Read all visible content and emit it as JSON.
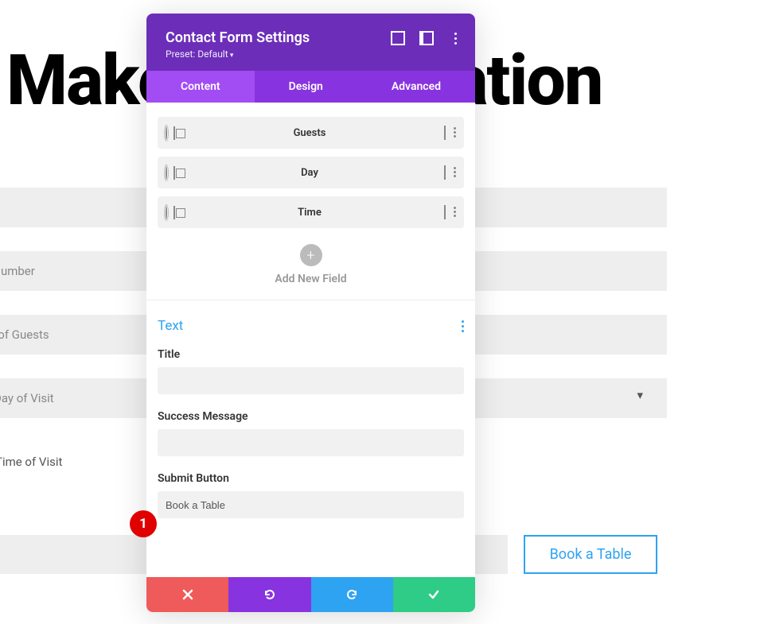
{
  "page": {
    "heading": "Make a Reservation",
    "inputs": {
      "phone": "Phone Number",
      "guests": "Number of Guests",
      "day": "Day of Visit",
      "time": "Time of Visit"
    },
    "cta_label": "Book a Table"
  },
  "modal": {
    "title": "Contact Form Settings",
    "preset": "Preset: Default",
    "tabs": {
      "content": "Content",
      "design": "Design",
      "advanced": "Advanced"
    },
    "fields": [
      {
        "label": "Guests"
      },
      {
        "label": "Day"
      },
      {
        "label": "Time"
      }
    ],
    "add_label": "Add New Field",
    "text_section": {
      "title": "Text",
      "title_label": "Title",
      "title_value": "",
      "success_label": "Success Message",
      "success_value": "",
      "submit_label": "Submit Button",
      "submit_value": "Book a Table"
    }
  },
  "annotation": {
    "num": "1"
  }
}
